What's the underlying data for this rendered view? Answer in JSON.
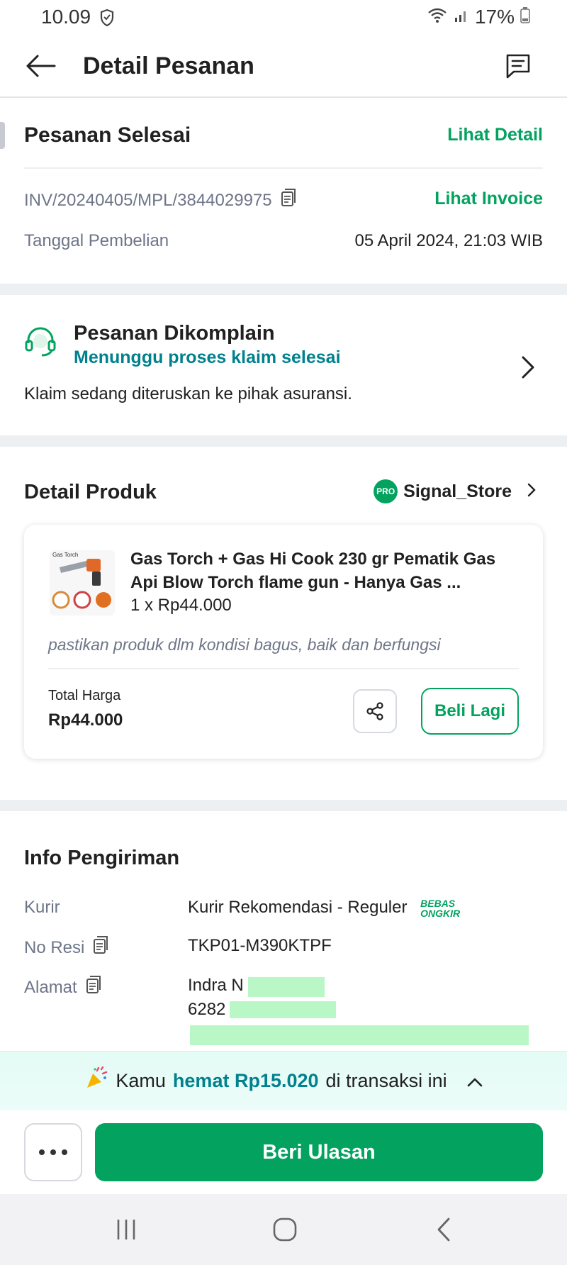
{
  "status_bar": {
    "time": "10.09",
    "battery": "17%"
  },
  "header": {
    "title": "Detail Pesanan"
  },
  "order": {
    "status": "Pesanan Selesai",
    "detail_link": "Lihat Detail",
    "invoice_number": "INV/20240405/MPL/3844029975",
    "invoice_link": "Lihat Invoice",
    "purchase_date_label": "Tanggal Pembelian",
    "purchase_date_value": "05 April 2024, 21:03 WIB"
  },
  "complaint": {
    "title": "Pesanan Dikomplain",
    "status": "Menunggu proses klaim selesai",
    "description": "Klaim sedang diteruskan ke pihak asuransi."
  },
  "product_section": {
    "title": "Detail Produk",
    "store_badge": "PRO",
    "store_name": "Signal_Store",
    "product": {
      "thumbnail_label": "Gas Torch",
      "name": "Gas Torch + Gas Hi Cook 230 gr Pematik Gas Api Blow Torch flame gun - Hanya Gas ...",
      "quantity_price": "1 x Rp44.000",
      "note": "pastikan produk dlm kondisi bagus, baik dan berfungsi",
      "total_label": "Total Harga",
      "total_value": "Rp44.000",
      "buy_again": "Beli Lagi"
    }
  },
  "shipping": {
    "title": "Info Pengiriman",
    "courier_label": "Kurir",
    "courier_value": "Kurir Rekomendasi - Reguler",
    "free_shipping_line1": "BEBAS",
    "free_shipping_line2": "ONGKIR",
    "resi_label": "No Resi",
    "resi_value": "TKP01-M390KTPF",
    "address_label": "Alamat",
    "address_name": "Indra N",
    "address_phone": "6282"
  },
  "savings": {
    "prefix": "Kamu",
    "amount": "hemat Rp15.020",
    "suffix": "di transaksi ini"
  },
  "actions": {
    "review_button": "Beri Ulasan"
  },
  "colors": {
    "accent": "#03a35f",
    "teal": "#00818e"
  }
}
